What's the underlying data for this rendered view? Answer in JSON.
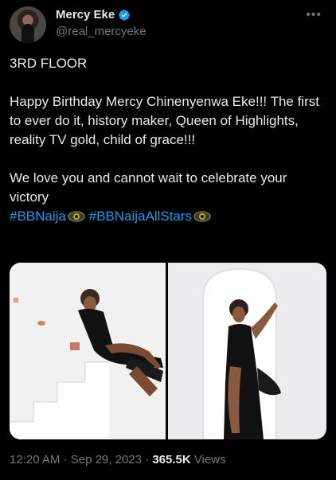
{
  "author": {
    "name": "Mercy Eke",
    "handle": "@real_mercyeke",
    "verified_icon": "verified-badge-icon"
  },
  "more_icon": "more-options-icon",
  "tweet": {
    "line1": "3RD FLOOR",
    "line2": "Happy Birthday Mercy Chinenyenwa Eke!!! The first to ever do it, history maker, Queen of Highlights, reality TV gold, child of grace!!!",
    "line3": "We love you and cannot wait to celebrate your victory",
    "hashtags": [
      "#BBNaija",
      "#BBNaijaAllStars"
    ],
    "hashtag_emoji": "eye-emoji-icon"
  },
  "media": {
    "photo1_icon": "photo-seated-on-stairs",
    "photo2_icon": "photo-standing-in-arch"
  },
  "meta": {
    "time": "12:20 AM",
    "separator": "·",
    "date": "Sep 29, 2023",
    "views_count": "365.5K",
    "views_label": "Views"
  },
  "colors": {
    "background": "#000000",
    "text": "#e7e9ea",
    "secondary": "#71767b",
    "link": "#1d9bf0"
  }
}
